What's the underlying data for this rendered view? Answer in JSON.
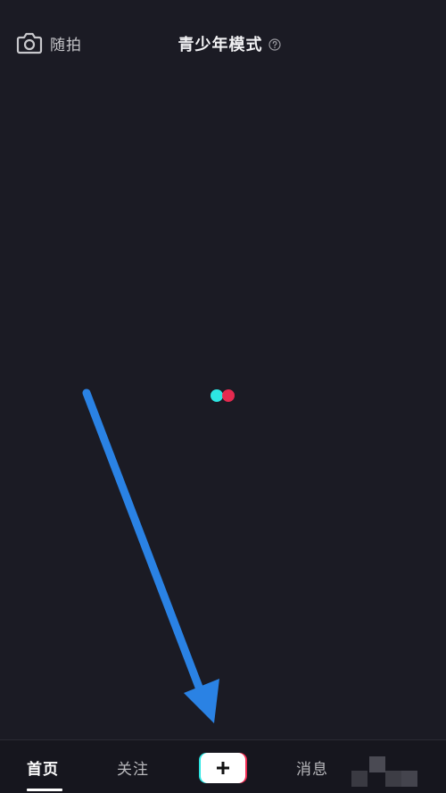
{
  "header": {
    "camera_label": "随拍",
    "mode_title": "青少年模式",
    "camera_icon": "camera-icon",
    "help_icon": "question-circle-icon"
  },
  "loader": {
    "colors": [
      "#2de6e3",
      "#f02b52"
    ]
  },
  "overlay": {
    "arrow_color": "#2a82e4"
  },
  "bottom_nav": {
    "home": "首页",
    "follow": "关注",
    "create_icon": "plus-icon",
    "messages": "消息"
  },
  "colors": {
    "background": "#1b1b24",
    "accent_cyan": "#2de6e3",
    "accent_red": "#f02b52"
  }
}
